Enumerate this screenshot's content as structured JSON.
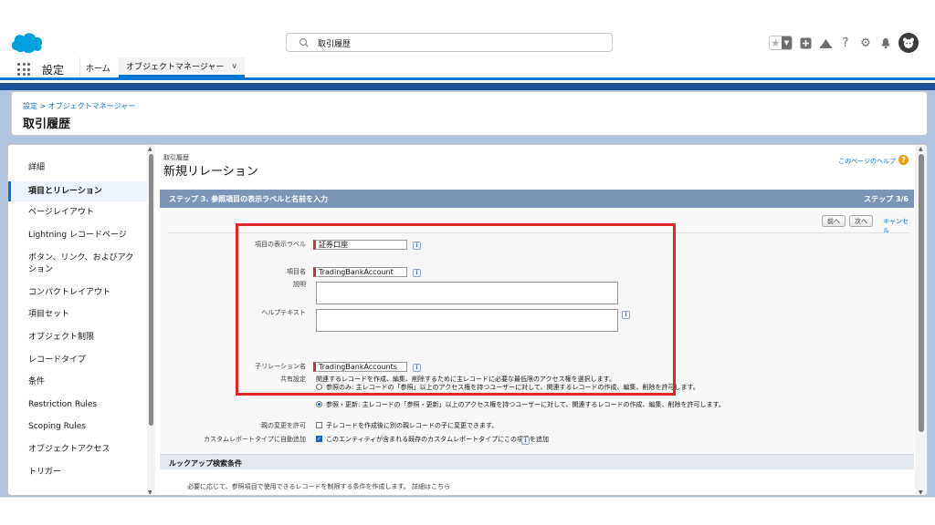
{
  "header": {
    "search_value": "取引履歴"
  },
  "app_nav": {
    "app_name": "設定",
    "home_tab": "ホーム",
    "object_manager_tab": "オブジェクトマネージャー"
  },
  "page_header": {
    "breadcrumb": "設定 > オブジェクトマネージャー",
    "title": "取引履歴"
  },
  "sidebar": {
    "items": [
      {
        "label": "詳細"
      },
      {
        "label": "項目とリレーション"
      },
      {
        "label": "ページレイアウト"
      },
      {
        "label": "Lightning レコードページ"
      },
      {
        "label": "ボタン、リンク、およびアク"
      },
      {
        "label": "ション"
      },
      {
        "label": "コンパクトレイアウト"
      },
      {
        "label": "項目セット"
      },
      {
        "label": "オブジェクト制限"
      },
      {
        "label": "レコードタイプ"
      },
      {
        "label": "条件"
      },
      {
        "label": "Restriction Rules"
      },
      {
        "label": "Scoping Rules"
      },
      {
        "label": "オブジェクトアクセス"
      },
      {
        "label": "トリガー"
      }
    ]
  },
  "content": {
    "object_label": "取引履歴",
    "title": "新規リレーション",
    "help_link": "このページのヘルプ",
    "step_title": "ステップ 3. 参照項目の表示ラベルと名前を入力",
    "step_count": "ステップ 3/6",
    "buttons": {
      "prev": "前へ",
      "next": "次へ",
      "cancel": "キャンセル"
    },
    "form": {
      "field_label_label": "項目の表示ラベル",
      "field_label_value": "証券口座",
      "field_name_label": "項目名",
      "field_name_value": "TradingBankAccount",
      "description_label": "説明",
      "help_text_label": "ヘルプテキスト",
      "child_rel_label": "子リレーション名",
      "child_rel_value": "TradingBankAccounts",
      "sharing_label": "共有設定",
      "sharing_desc": "関連するレコードを作成、編集、削除するために主レコードに必要な最低限のアクセス権を選択します。",
      "sharing_opt1": "参照のみ: 主レコードの「参照」以上のアクセス権を持つユーザーに対して、関連するレコードの作成、編集、削除を許可します。",
      "sharing_opt2": "参照・更新: 主レコードの「参照・更新」以上のアクセス権を持つユーザーに対して、関連するレコードの作成、編集、削除を許可します。",
      "reparent_label": "親の変更を許可",
      "reparent_text": "子レコードを作成後に別の親レコードの子に変更できます。",
      "auto_add_label": "カスタムレポートタイプに自動追加",
      "auto_add_text": "このエンティティが含まれる既存のカスタムレポートタイプにこの項目を追加"
    },
    "lookup_section_title": "ルックアップ検索条件",
    "lookup_section_note": "必要に応じて、参照項目で使用できるレコードを制限する条件を作成します。 詳細はこちら"
  },
  "colors": {
    "brand_blue": "#0176d3",
    "required_red": "#c23934",
    "highlight_red": "#e0262b",
    "step_bar": "#7b96b9"
  }
}
